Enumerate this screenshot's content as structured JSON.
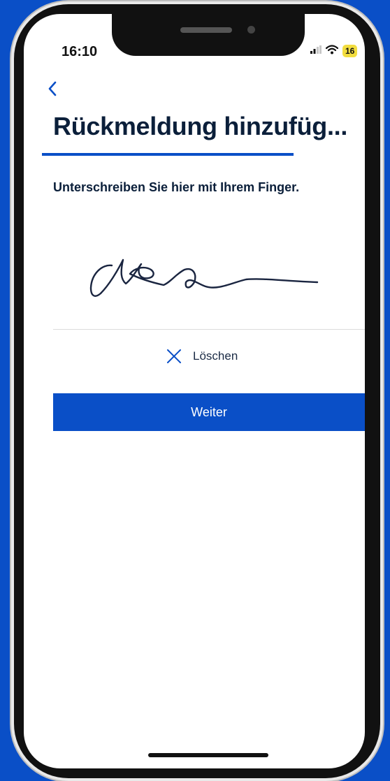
{
  "status_bar": {
    "time": "16:10",
    "battery": "16"
  },
  "header": {
    "title": "Rückmeldung hinzufüg..."
  },
  "signature": {
    "instruction": "Unterschreiben Sie hier mit Ihrem Finger.",
    "clear_label": "Löschen"
  },
  "actions": {
    "next_label": "Weiter"
  },
  "colors": {
    "accent": "#0a4fc7",
    "background": "#0a4fc7",
    "title_text": "#0b1f3a",
    "battery": "#f2dd3f"
  },
  "icons": {
    "back": "chevron-left-icon",
    "clear": "close-icon",
    "signal": "signal-icon",
    "wifi": "wifi-icon",
    "battery": "battery-icon"
  }
}
